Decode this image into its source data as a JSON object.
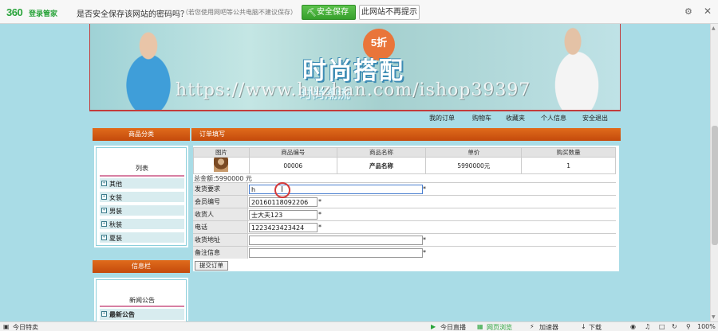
{
  "password_bar": {
    "logo": "360",
    "logo_sub": "登录管家",
    "prompt": "是否安全保存该网站的密码吗？",
    "prompt_note": "（若您使用网吧等公共电脑不建议保存）",
    "save_button": "安全保存",
    "never_button": "此网站不再提示",
    "settings_icon": "gear-icon",
    "close_icon": "close-icon"
  },
  "banner": {
    "title": "时尚搭配",
    "badge": "5折",
    "subtitle": "时尚潮流",
    "watermark": "https://www.huzhan.com/ishop39397"
  },
  "top_links": [
    "我的订单",
    "购物车",
    "收藏夹",
    "个人信息",
    "安全退出"
  ],
  "sidebar": {
    "category_header": "商品分类",
    "list_title": "列表",
    "categories": [
      "其他",
      "女装",
      "男装",
      "秋装",
      "夏装"
    ],
    "info_header": "信息栏",
    "news_title": "新闻公告",
    "latest_notice": "最新公告"
  },
  "order": {
    "header": "订单填写",
    "columns": [
      "图片",
      "商品编号",
      "商品名称",
      "单价",
      "购买数量"
    ],
    "items": [
      {
        "id": "00006",
        "name": "产品名称",
        "price": "5990000元",
        "qty": "1"
      }
    ],
    "total_label": "总金额:",
    "total_value": "5990000",
    "total_unit": "元",
    "form": {
      "shipping_req": {
        "label": "发货要求",
        "value": "h"
      },
      "member_id": {
        "label": "会员编号",
        "value": "20160118092206"
      },
      "receiver": {
        "label": "收货人",
        "value": "士大夫123"
      },
      "phone": {
        "label": "电话",
        "value": "1223423423424"
      },
      "address": {
        "label": "收货地址",
        "value": ""
      },
      "notes": {
        "label": "备注信息",
        "value": ""
      }
    },
    "required_mark": "*",
    "submit_label": "提交订单"
  },
  "status_bar": {
    "left": "今日特卖",
    "live": "今日直播",
    "mode": "网页浏览",
    "accel": "加速器",
    "download": "下载",
    "zoom": "100%"
  }
}
